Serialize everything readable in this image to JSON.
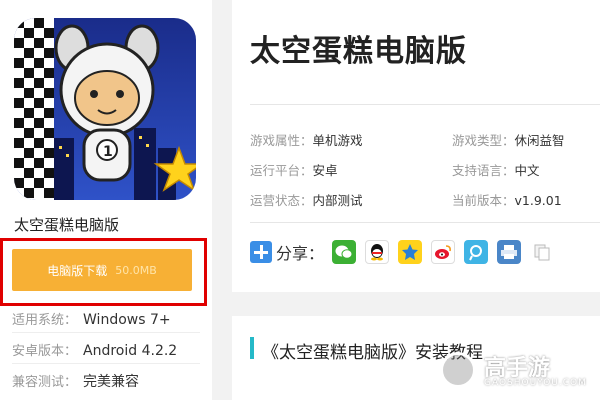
{
  "app": {
    "name": "太空蛋糕电脑版",
    "download_label": "电脑版下载",
    "download_size": "50.0MB"
  },
  "left_info": [
    {
      "label": "适用系统：",
      "value": "Windows 7+"
    },
    {
      "label": "安卓版本：",
      "value": "Android 4.2.2"
    },
    {
      "label": "兼容测试：",
      "value": "完美兼容"
    }
  ],
  "main": {
    "title": "太空蛋糕电脑版",
    "attrs": [
      {
        "label": "游戏属性：",
        "value": "单机游戏"
      },
      {
        "label": "游戏类型：",
        "value": "休闲益智"
      },
      {
        "label": "运行平台：",
        "value": "安卓"
      },
      {
        "label": "支持语言：",
        "value": "中文"
      },
      {
        "label": "运营状态：",
        "value": "内部测试"
      },
      {
        "label": "当前版本：",
        "value": "v1.9.01"
      }
    ],
    "share_label": "分享：",
    "share_icons": [
      "wechat-icon",
      "qq-icon",
      "qzone-icon",
      "weibo-icon",
      "tencent-weibo-icon",
      "print-icon",
      "copy-icon"
    ]
  },
  "tutorial": {
    "title": "《太空蛋糕电脑版》安装教程"
  },
  "watermark": {
    "brand": "高手游",
    "domain": "GAOSHOUYOU.COM"
  },
  "colors": {
    "download_button": "#f7b035",
    "highlight_frame": "#e00000",
    "accent_bar": "#25b9c8"
  }
}
